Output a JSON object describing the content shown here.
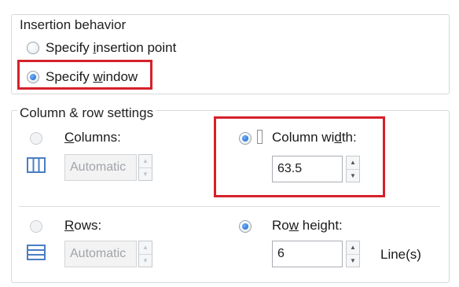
{
  "insertion_behavior": {
    "title": "Insertion behavior",
    "options": [
      {
        "label_before": "Specify ",
        "label_mnemonic": "i",
        "label_after": "nsertion point",
        "selected": false
      },
      {
        "label_before": "Specify ",
        "label_mnemonic": "w",
        "label_after": "indow",
        "selected": true
      }
    ]
  },
  "column_row_settings": {
    "title": "Column & row settings",
    "columns": {
      "label_mnemonic": "C",
      "label_after": "olumns:",
      "value": "Automatic",
      "enabled": false
    },
    "column_width": {
      "label_before": "Column wi",
      "label_mnemonic": "d",
      "label_after": "th:",
      "value": "63.5",
      "selected": true
    },
    "rows": {
      "label_mnemonic": "R",
      "label_after": "ows:",
      "value": "Automatic",
      "enabled": false
    },
    "row_height": {
      "label_before": "Ro",
      "label_mnemonic": "w",
      "label_after": " height:",
      "value": "6",
      "unit": "Line(s)",
      "selected": true
    }
  },
  "colors": {
    "highlight": "#d6212b",
    "radio_selected": "#1a5fbf"
  }
}
